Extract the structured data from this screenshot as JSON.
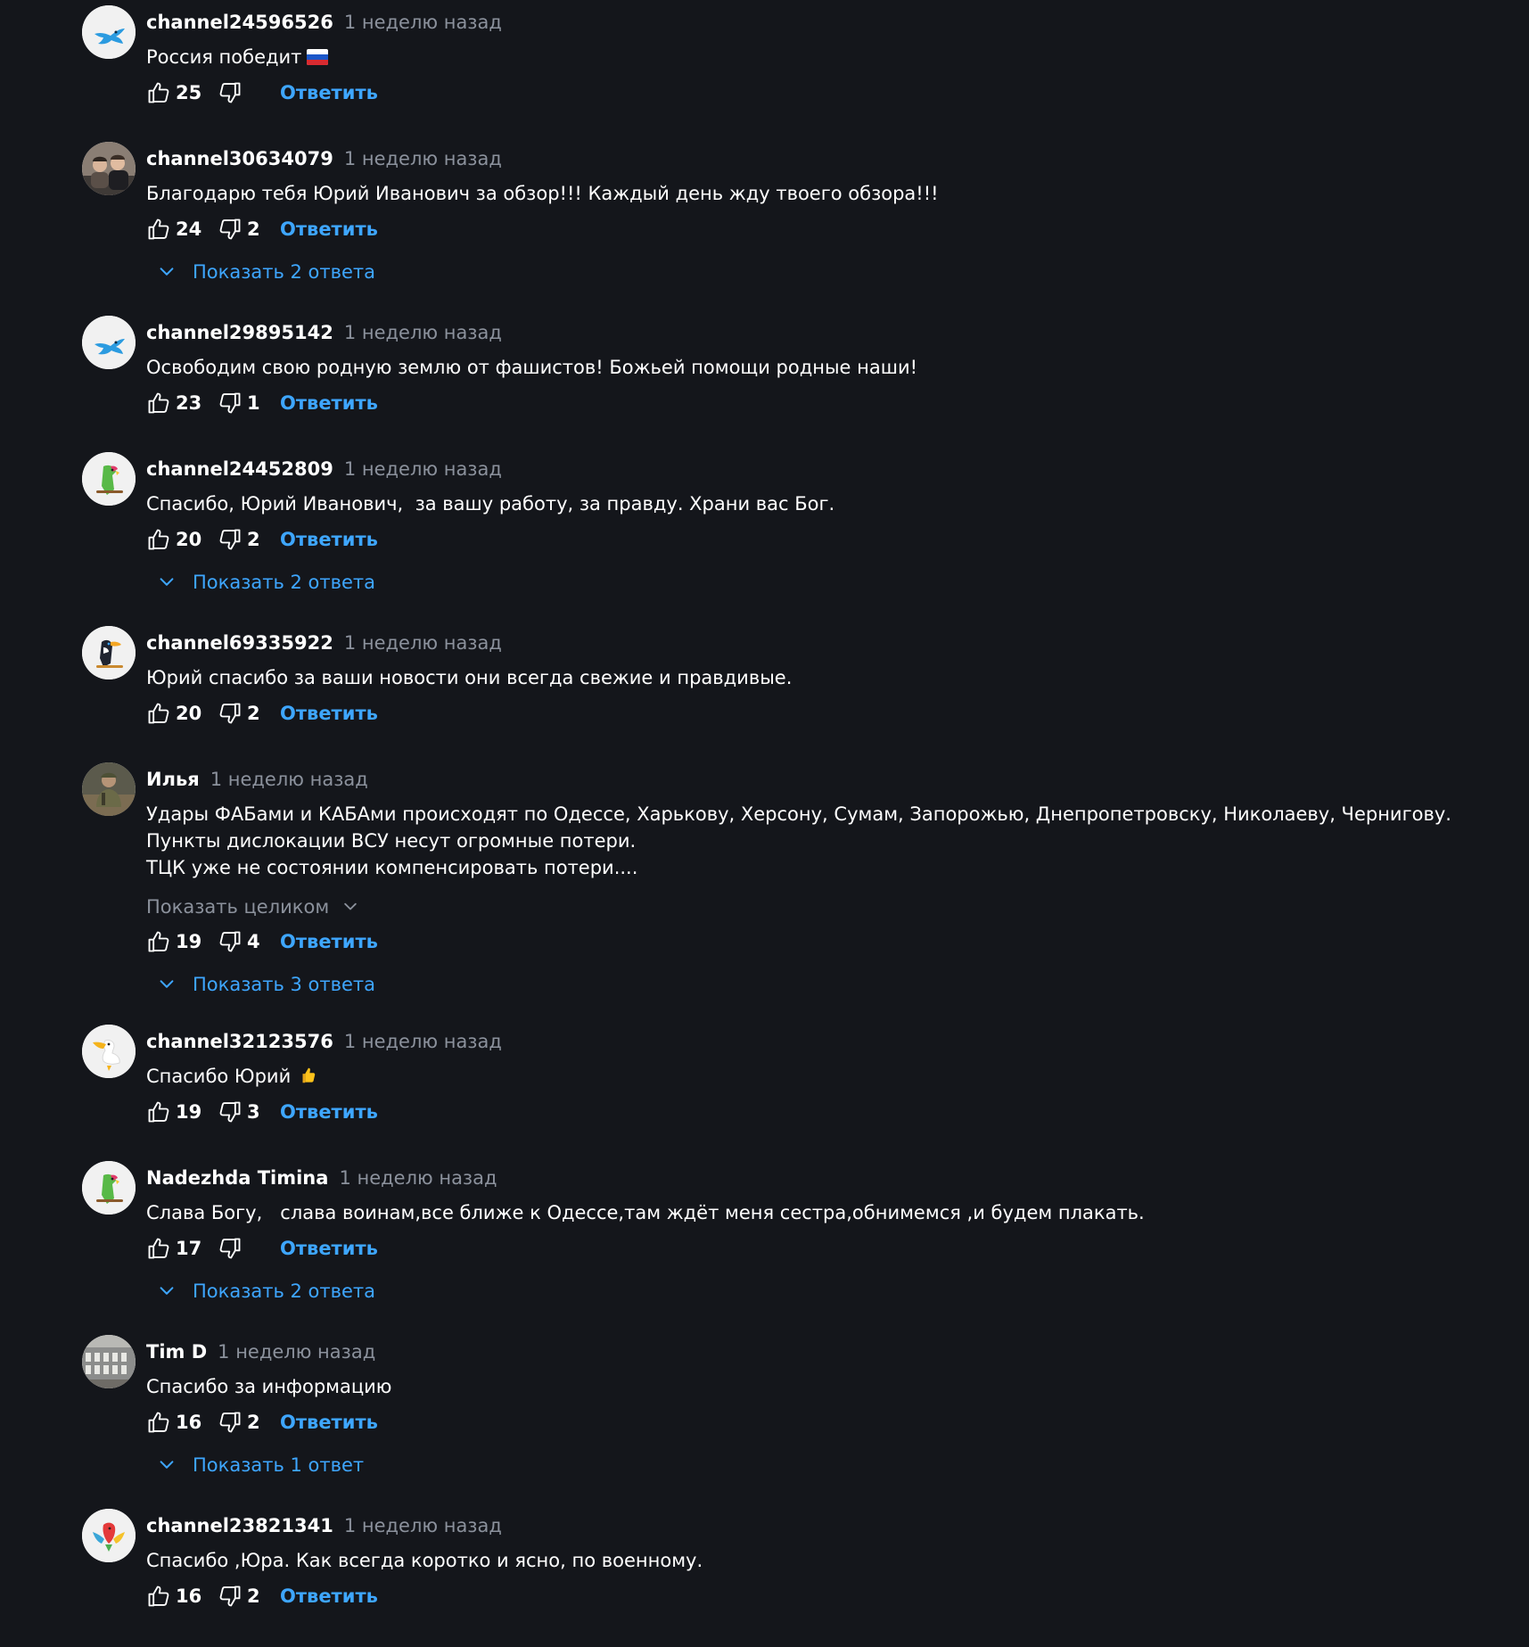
{
  "reply_label": "Ответить",
  "comments": [
    {
      "author": "channel24596526",
      "time": "1 неделю назад",
      "text": "Россия победит",
      "emoji": "russian-flag",
      "likes": "25",
      "dislikes": "",
      "show_replies": "",
      "avatar": "blue-bird"
    },
    {
      "author": "channel30634079",
      "time": "1 неделю назад",
      "text": "Благодарю тебя Юрий Иванович за обзор!!! Каждый день жду твоего обзора!!!",
      "likes": "24",
      "dislikes": "2",
      "show_replies": "Показать 2 ответа",
      "avatar": "photo-two-people"
    },
    {
      "author": "channel29895142",
      "time": "1 неделю назад",
      "text": "Освободим свою родную землю от фашистов! Божьей помощи родные наши!",
      "likes": "23",
      "dislikes": "1",
      "show_replies": "",
      "avatar": "blue-bird"
    },
    {
      "author": "channel24452809",
      "time": "1 неделю назад",
      "text": "Спасибо, Юрий Иванович,  за вашу работу, за правду. Храни вас Бог.",
      "likes": "20",
      "dislikes": "2",
      "show_replies": "Показать 2 ответа",
      "avatar": "green-parrot"
    },
    {
      "author": "channel69335922",
      "time": "1 неделю назад",
      "text": "Юрий спасибо за ваши новости они всегда свежие и правдивые.",
      "likes": "20",
      "dislikes": "2",
      "show_replies": "",
      "avatar": "toucan"
    },
    {
      "author": "Илья",
      "time": "1 неделю назад",
      "text": "Удары ФАБами и КАБАми происходят по Одессе, Харькову, Херсону, Сумам, Запорожью, Днепропетровску, Николаеву, Чернигову.\nПункты дислокации ВСУ несут огромные потери.\nТЦК уже не состоянии компенсировать потери....",
      "expand": "Показать целиком",
      "likes": "19",
      "dislikes": "4",
      "show_replies": "Показать 3 ответа",
      "avatar": "photo-soldier"
    },
    {
      "author": "channel32123576",
      "time": "1 неделю назад",
      "text": "Спасибо Юрий",
      "emoji": "thumbs-up",
      "likes": "19",
      "dislikes": "3",
      "show_replies": "",
      "avatar": "pelican"
    },
    {
      "author": "Nadezhda Timina",
      "time": "1 неделю назад",
      "text": "Слава Богу,   слава воинам,все ближе к Одессе,там ждёт меня сестра,обнимемся ,и будем плакать.",
      "likes": "17",
      "dislikes": "",
      "show_replies": "Показать 2 ответа",
      "avatar": "green-parrot"
    },
    {
      "author": "Tim D",
      "time": "1 неделю назад",
      "text": "Спасибо за информацию",
      "likes": "16",
      "dislikes": "2",
      "show_replies": "Показать 1 ответ",
      "avatar": "photo-building"
    },
    {
      "author": "channel23821341",
      "time": "1 неделю назад",
      "text": "Спасибо ,Юра. Как всегда коротко и ясно, по военному.",
      "likes": "16",
      "dislikes": "2",
      "show_replies": "",
      "avatar": "red-parrot"
    }
  ]
}
